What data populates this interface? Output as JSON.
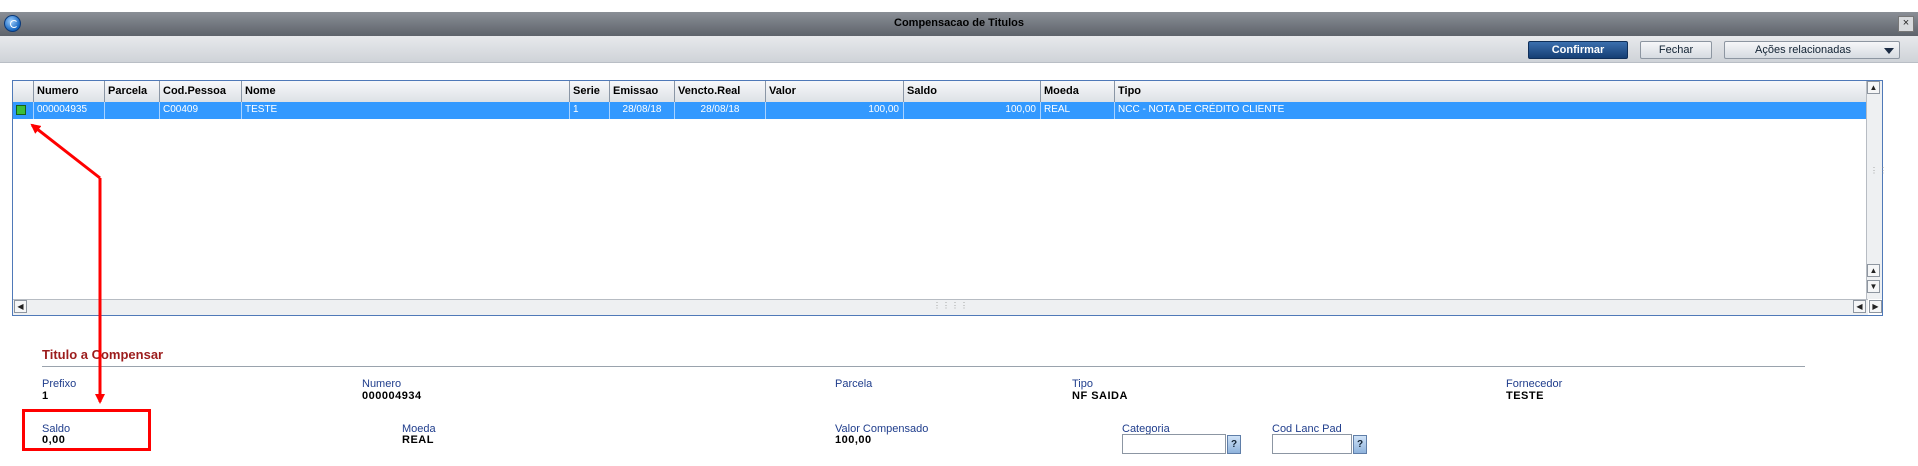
{
  "window": {
    "title": "Compensacao de Titulos",
    "close_glyph": "×",
    "app_icon": "app-logo-icon"
  },
  "toolbar": {
    "confirm_label": "Confirmar",
    "close_label": "Fechar",
    "actions_label": "Ações relacionadas"
  },
  "grid": {
    "columns": [
      "Numero",
      "Parcela",
      "Cod.Pessoa",
      "Nome",
      "Serie",
      "Emissao",
      "Vencto.Real",
      "Valor",
      "Saldo",
      "Moeda",
      "Tipo"
    ],
    "rows": [
      {
        "numero": "000004935",
        "parcela": "",
        "cod_pessoa": "C00409",
        "nome": "TESTE",
        "serie": "1",
        "emissao": "28/08/18",
        "vencto_real": "28/08/18",
        "valor": "100,00",
        "saldo": "100,00",
        "moeda": "REAL",
        "tipo": "NCC - NOTA DE CRÉDITO CLIENTE",
        "marker_color": "#3cbf3c"
      }
    ],
    "selected_row_color": "#3399ff"
  },
  "section": {
    "title": "Titulo a Compensar",
    "fields": {
      "prefixo": {
        "label": "Prefixo",
        "value": "1"
      },
      "numero": {
        "label": "Numero",
        "value": "000004934"
      },
      "parcela": {
        "label": "Parcela",
        "value": ""
      },
      "tipo": {
        "label": "Tipo",
        "value": "NF SAIDA"
      },
      "fornecedor": {
        "label": "Fornecedor",
        "value": "TESTE"
      },
      "saldo": {
        "label": "Saldo",
        "value": "0,00"
      },
      "moeda": {
        "label": "Moeda",
        "value": "REAL"
      },
      "valor_compensado": {
        "label": "Valor Compensado",
        "value": "100,00"
      },
      "categoria": {
        "label": "Categoria",
        "value": "",
        "help": "?"
      },
      "cod_lanc_pad": {
        "label": "Cod Lanc Pad",
        "value": "",
        "help": "?"
      }
    }
  },
  "annotation_color": "#ff0000"
}
